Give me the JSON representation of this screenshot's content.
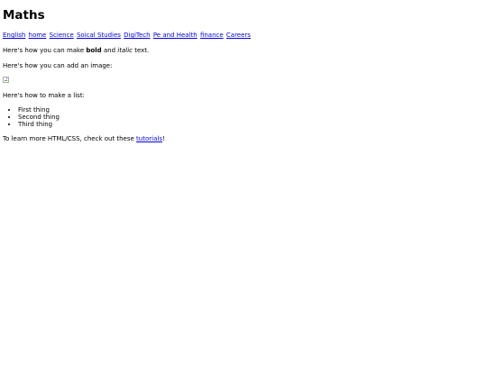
{
  "page": {
    "title": "Maths"
  },
  "nav": {
    "links": [
      "English",
      "home",
      "Science",
      "Soical Studies",
      "DigiTech",
      "Pe and Health",
      "finance",
      "Careers"
    ]
  },
  "content": {
    "bold_intro": "Here's how you can make ",
    "bold_word": "bold",
    "bold_and": " and ",
    "italic_word": "italic",
    "bold_outro": " text.",
    "image_intro": "Here's how you can add an image:",
    "list_intro": "Here's how to make a list:",
    "list_items": [
      "First thing",
      "Second thing",
      "Third thing"
    ],
    "learn_intro": "To learn more HTML/CSS, check out these ",
    "learn_link": "tutorials",
    "learn_outro": "!"
  },
  "colors": {
    "link": "#0000ee",
    "text": "#000000",
    "background": "#ffffff"
  },
  "icons": {
    "broken_image": "broken-image-icon"
  }
}
